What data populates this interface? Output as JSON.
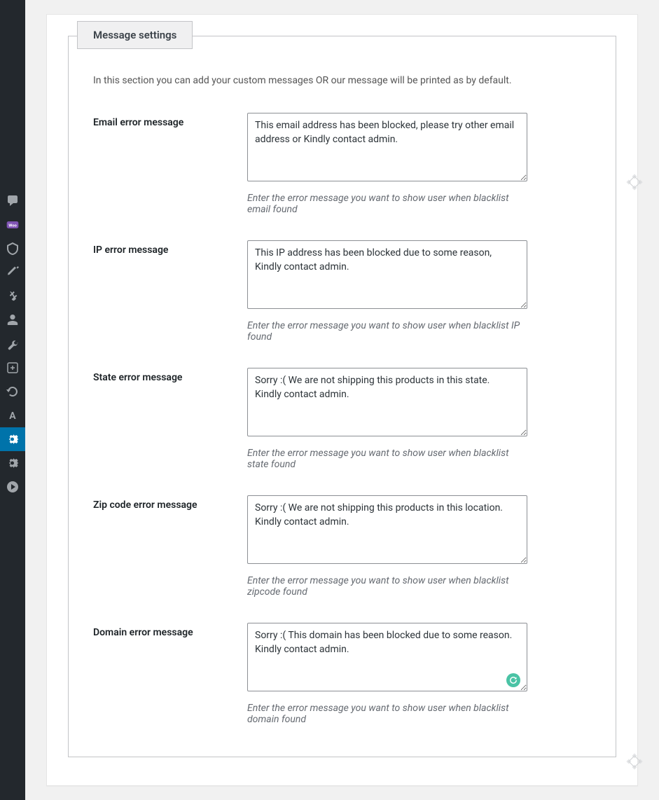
{
  "sidebar": {
    "items": [
      {
        "name": "comments"
      },
      {
        "name": "woocommerce"
      },
      {
        "name": "products"
      },
      {
        "name": "appearance"
      },
      {
        "name": "plugins"
      },
      {
        "name": "users"
      },
      {
        "name": "tools"
      },
      {
        "name": "extra"
      },
      {
        "name": "refresh"
      },
      {
        "name": "typography"
      },
      {
        "name": "settings-active"
      },
      {
        "name": "settings"
      },
      {
        "name": "media"
      }
    ]
  },
  "fieldset": {
    "legend": "Message settings",
    "intro": "In this section you can add your custom messages OR our message will be printed as by default."
  },
  "fields": {
    "email": {
      "label": "Email error message",
      "value": "This email address has been blocked, please try other email address or Kindly contact admin.",
      "hint": "Enter the error message you want to show user when blacklist email found"
    },
    "ip": {
      "label": "IP error message",
      "value": "This IP address has been blocked due to some reason, Kindly contact admin.",
      "hint": "Enter the error message you want to show user when blacklist IP found"
    },
    "state": {
      "label": "State error message",
      "value": "Sorry :( We are not shipping this products in this state.  Kindly contact admin.",
      "hint": "Enter the error message you want to show user when blacklist state found"
    },
    "zip": {
      "label": "Zip code error message",
      "value": "Sorry :( We are not shipping this products in this location. Kindly contact admin.",
      "hint": "Enter the error message you want to show user when blacklist zipcode found"
    },
    "domain": {
      "label": "Domain error message",
      "value": "Sorry :( This domain has been blocked due to some reason. Kindly contact admin.",
      "hint": "Enter the error message you want to show user when blacklist domain found"
    }
  }
}
